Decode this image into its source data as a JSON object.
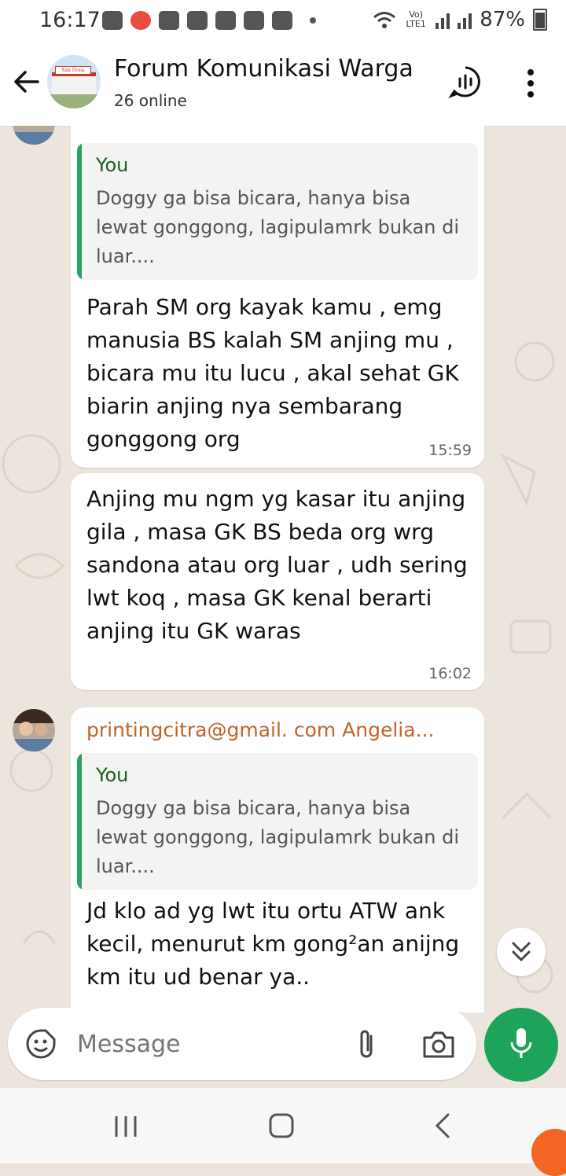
{
  "status_bar": {
    "time": "16:17",
    "carrier": "Vo) LTE1",
    "battery": "87%"
  },
  "header": {
    "title": "Forum Komunikasi Warga",
    "subtitle": "26 online",
    "avatar_caption": "San Dona"
  },
  "messages": [
    {
      "quote_sender": "You",
      "quote_text": "Doggy ga bisa bicara, hanya bisa lewat gonggong, lagipulamrk bukan di luar....",
      "text": "Parah SM org kayak kamu , emg manusia BS kalah SM anjing mu , bicara mu itu lucu , akal sehat GK biarin anjing nya sembarang gonggong org",
      "time": "15:59"
    },
    {
      "text": "Anjing mu ngm yg kasar itu anjing gila , masa GK BS beda org wrg sandona atau org luar , udh sering lwt koq , masa GK kenal berarti anjing itu GK waras",
      "time": "16:02"
    },
    {
      "sender": "printingcitra@gmail. com Angelia...",
      "quote_sender": "You",
      "quote_text": "Doggy ga bisa bicara, hanya bisa lewat gonggong, lagipulamrk bukan di luar....",
      "text": "Jd klo ad yg lwt itu ortu ATW ank kecil, menurut km gong²an anijng km itu ud benar ya.."
    }
  ],
  "composer": {
    "placeholder": "Message"
  },
  "colors": {
    "accent_green": "#1ea45a",
    "quote_bar": "#25a45f",
    "sender_name": "#c0642a",
    "chat_background": "#ece5dd"
  }
}
